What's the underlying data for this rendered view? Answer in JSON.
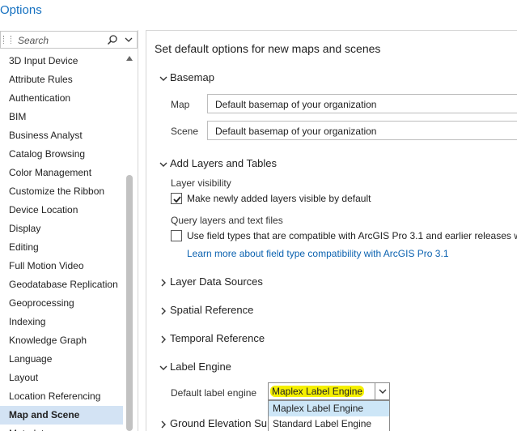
{
  "window": {
    "title": "Options"
  },
  "sidebar": {
    "search_placeholder": "Search",
    "items": [
      {
        "label": "3D Input Device"
      },
      {
        "label": "Attribute Rules"
      },
      {
        "label": "Authentication"
      },
      {
        "label": "BIM"
      },
      {
        "label": "Business Analyst"
      },
      {
        "label": "Catalog Browsing"
      },
      {
        "label": "Color Management"
      },
      {
        "label": "Customize the Ribbon"
      },
      {
        "label": "Device Location"
      },
      {
        "label": "Display"
      },
      {
        "label": "Editing"
      },
      {
        "label": "Full Motion Video"
      },
      {
        "label": "Geodatabase Replication"
      },
      {
        "label": "Geoprocessing"
      },
      {
        "label": "Indexing"
      },
      {
        "label": "Knowledge Graph"
      },
      {
        "label": "Language"
      },
      {
        "label": "Layout"
      },
      {
        "label": "Location Referencing"
      },
      {
        "label": "Map and Scene",
        "selected": true
      },
      {
        "label": "Metadata"
      }
    ]
  },
  "main": {
    "heading": "Set default options for new maps and scenes",
    "basemap": {
      "title": "Basemap",
      "map_label": "Map",
      "map_value": "Default basemap of your organization",
      "scene_label": "Scene",
      "scene_value": "Default basemap of your organization"
    },
    "add_layers": {
      "title": "Add Layers and Tables",
      "layer_visibility_label": "Layer visibility",
      "visible_checkbox_label": "Make newly added layers visible by default",
      "visible_checked": true,
      "query_label": "Query layers and text files",
      "field_types_checkbox_label": "Use field types that are compatible with ArcGIS Pro 3.1 and earlier releases when",
      "field_types_checked": false,
      "learn_more_link": "Learn more about field type compatibility with ArcGIS Pro 3.1"
    },
    "collapsed_sections": {
      "layer_data_sources": "Layer Data Sources",
      "spatial_reference": "Spatial Reference",
      "temporal_reference": "Temporal Reference"
    },
    "label_engine": {
      "title": "Label Engine",
      "default_label": "Default label engine",
      "selected": "Maplex Label Engine",
      "options": [
        "Maplex Label Engine",
        "Standard Label Engine"
      ],
      "highlight_color": "#f5f000"
    },
    "ground_elevation": {
      "title": "Ground Elevation Su"
    }
  }
}
